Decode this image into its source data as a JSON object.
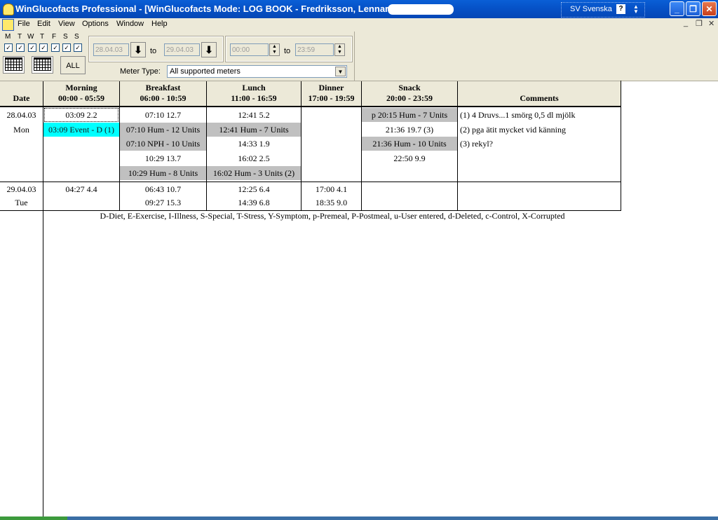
{
  "window": {
    "title": "WinGlucofacts Professional - [WinGlucofacts Mode: LOG BOOK - Fredriksson, Lennart,",
    "language": "SV Svenska",
    "help": "?"
  },
  "menu": [
    "File",
    "Edit",
    "View",
    "Options",
    "Window",
    "Help"
  ],
  "toolbar": {
    "days": [
      "M",
      "T",
      "W",
      "T",
      "F",
      "S",
      "S"
    ],
    "all_label": "ALL",
    "date_from": "28.04.03",
    "date_to": "29.04.03",
    "time_from": "00:00",
    "time_to": "23:59",
    "to_label": "to",
    "meter_type_label": "Meter Type:",
    "meter_type_value": "All supported meters"
  },
  "columns": [
    {
      "l1": "Date",
      "l2": ""
    },
    {
      "l1": "Morning",
      "l2": "00:00 - 05:59"
    },
    {
      "l1": "Breakfast",
      "l2": "06:00 - 10:59"
    },
    {
      "l1": "Lunch",
      "l2": "11:00 - 16:59"
    },
    {
      "l1": "Dinner",
      "l2": "17:00 - 19:59"
    },
    {
      "l1": "Snack",
      "l2": "20:00 - 23:59"
    },
    {
      "l1": "Comments",
      "l2": ""
    }
  ],
  "rows": [
    {
      "date": "28.04.03",
      "weekday": "Mon",
      "morning": [
        "03:09   2.2",
        "03:09 Event - D (1)"
      ],
      "breakfast": [
        "07:10  12.7",
        "07:10 Hum - 12 Units",
        "07:10 NPH - 10 Units",
        "10:29  13.7",
        "10:29 Hum - 8 Units"
      ],
      "lunch": [
        "12:41   5.2",
        "12:41 Hum - 7 Units",
        "14:33   1.9",
        "16:02   2.5",
        "16:02 Hum - 3 Units  (2)"
      ],
      "dinner": [],
      "snack": [
        "p 20:15 Hum - 7 Units",
        "21:36  19.7  (3)",
        "21:36 Hum - 10 Units",
        "22:50   9.9"
      ],
      "comments": [
        "(1) 4 Druvs...1 smörg 0,5 dl mjölk",
        "(2) pga ätit mycket vid känning",
        "(3) rekyl?"
      ]
    },
    {
      "date": "29.04.03",
      "weekday": "Tue",
      "morning": [
        "04:27   4.4"
      ],
      "breakfast": [
        "06:43  10.7",
        "09:27  15.3"
      ],
      "lunch": [
        "12:25   6.4",
        "14:39   6.8"
      ],
      "dinner": [
        "17:00   4.1",
        "18:35   9.0"
      ],
      "snack": [],
      "comments": []
    }
  ],
  "legend": "D-Diet, E-Exercise, I-Illness, S-Special, T-Stress, Y-Symptom, p-Premeal, P-Postmeal, u-User entered, d-Deleted, c-Control, X-Corrupted",
  "colors": {
    "insulin_bg": "#c0c0c0",
    "event_bg": "#00ffff",
    "titlebar": "#0a5fd6"
  }
}
